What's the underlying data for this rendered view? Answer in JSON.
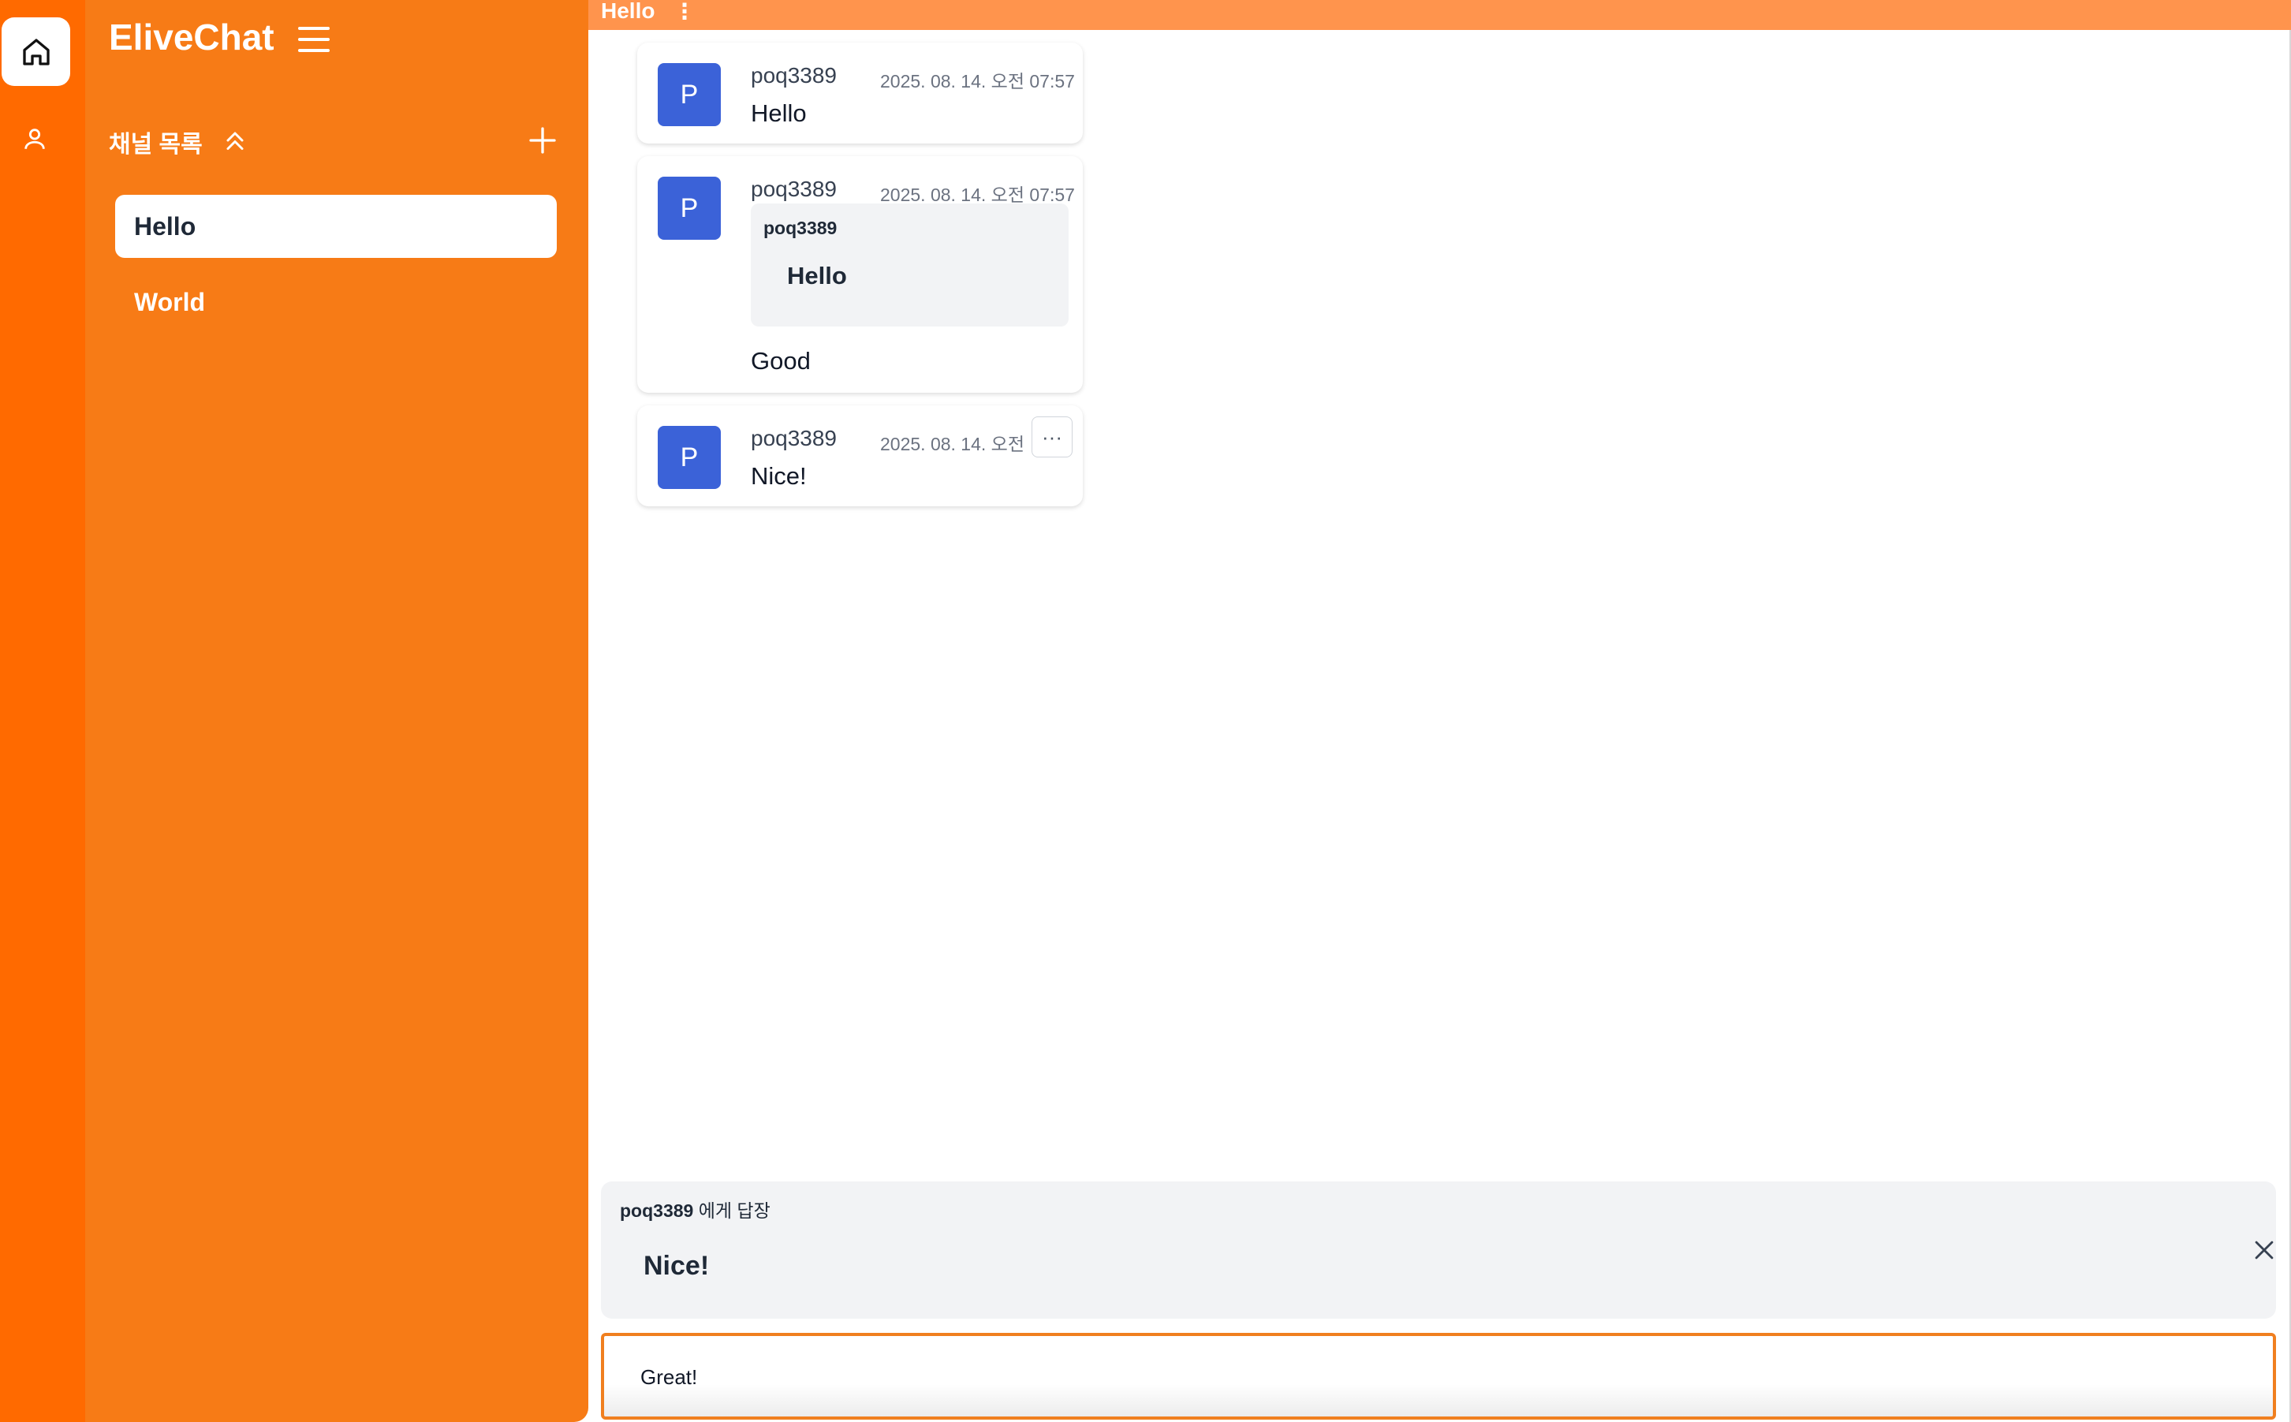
{
  "app": {
    "name": "EliveChat"
  },
  "sidebar": {
    "channels_header": "채널 목록",
    "channels": [
      {
        "label": "Hello",
        "active": true
      },
      {
        "label": "World",
        "active": false
      }
    ]
  },
  "channel": {
    "title": "Hello",
    "menu_glyph": "⋮"
  },
  "messages": [
    {
      "avatar": "P",
      "author": "poq3389",
      "time": "2025. 08. 14. 오전 07:57",
      "text": "Hello"
    },
    {
      "avatar": "P",
      "author": "poq3389",
      "time": "2025. 08. 14. 오전 07:57",
      "quote": {
        "author": "poq3389",
        "text": "Hello"
      },
      "text": "Good"
    },
    {
      "avatar": "P",
      "author": "poq3389",
      "time": "2025. 08. 14. 오전 0",
      "text": "Nice!",
      "more": "···"
    }
  ],
  "reply": {
    "target": "poq3389",
    "suffix": " 에게 답장",
    "text": "Nice!"
  },
  "composer": {
    "value": "Great!"
  },
  "colors": {
    "rail": "#ff6a00",
    "sidebar": "#f77b16",
    "topbar": "#ff944d",
    "avatar": "#3b62d8",
    "composer_border": "#f07f1f"
  },
  "icons": [
    "home-icon",
    "user-icon",
    "menu-icon",
    "chevrons-up-icon",
    "plus-icon",
    "more-icon",
    "close-icon"
  ]
}
